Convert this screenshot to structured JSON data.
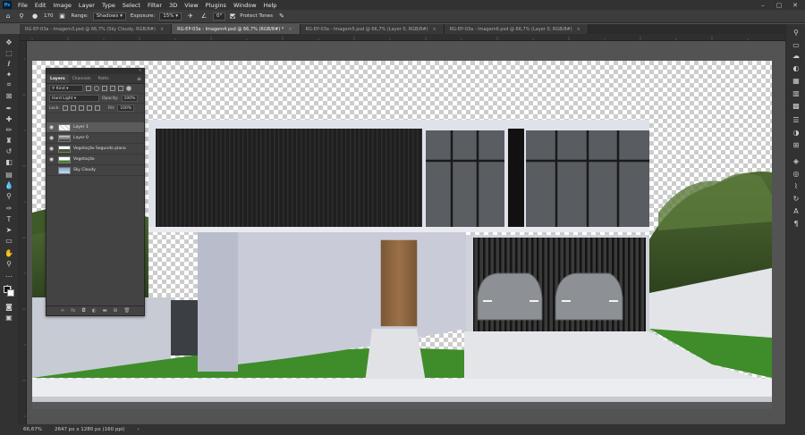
{
  "app": {
    "menu": [
      "File",
      "Edit",
      "Image",
      "Layer",
      "Type",
      "Select",
      "Filter",
      "3D",
      "View",
      "Plugins",
      "Window",
      "Help"
    ],
    "logo_text": "Ps"
  },
  "options": {
    "brush_size": "170",
    "range_label": "Range:",
    "range_value": "Shadows",
    "exposure_label": "Exposure:",
    "exposure_value": "15%",
    "angle_value": "0°",
    "protect_tones_label": "Protect Tones"
  },
  "tabs": [
    {
      "label": "RG-EP-03a - Imagem3.psd @ 66,7% (Sky Cloudy, RGB/8#)",
      "active": false
    },
    {
      "label": "RG-EP-03a - Imagem4.psd @ 66,7% (RGB/8#) *",
      "active": true
    },
    {
      "label": "RG-EP-03a - Imagem5.psd @ 66,7% (Layer 0, RGB/8#)",
      "active": false
    },
    {
      "label": "RG-EP-03a - Imagem6.psd @ 66,7% (Layer 0, RGB/8#)",
      "active": false
    }
  ],
  "layers_panel": {
    "tabs": [
      "Layers",
      "Channels",
      "Paths"
    ],
    "kind_label": "Kind",
    "blend_mode": "Hard Light",
    "opacity_label": "Opacity:",
    "opacity_value": "100%",
    "lock_label": "Lock:",
    "fill_label": "Fill:",
    "fill_value": "100%",
    "layers": [
      {
        "name": "Layer 1",
        "visible": true,
        "selected": true
      },
      {
        "name": "Layer 0",
        "visible": true,
        "selected": false
      },
      {
        "name": "Vegetação Segundo plano",
        "visible": true,
        "selected": false
      },
      {
        "name": "Vegetação",
        "visible": true,
        "selected": false
      },
      {
        "name": "Sky Cloudy",
        "visible": false,
        "selected": false
      }
    ]
  },
  "status": {
    "zoom": "66,67%",
    "doc_info": "2647 px x 1280 px (160 ppi)"
  }
}
